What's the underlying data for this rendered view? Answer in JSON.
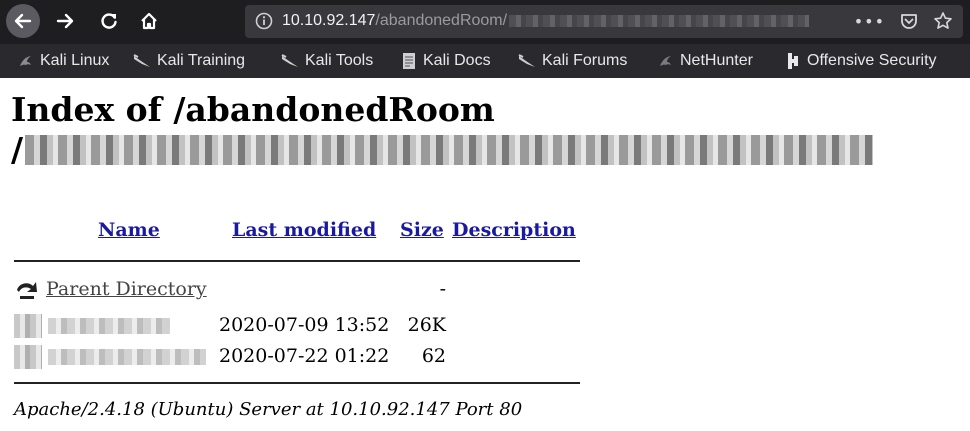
{
  "browser": {
    "url_host": "10.10.92.147",
    "url_path": "/abandonedRoom/",
    "more_label": "•••",
    "icons": [
      "back-icon",
      "forward-icon",
      "reload-icon",
      "home-icon",
      "info-icon",
      "pocket-icon",
      "bookmark-star-icon"
    ]
  },
  "bookmarks": [
    {
      "label": "Kali Linux",
      "icon": "kali-dragon-icon"
    },
    {
      "label": "Kali Training",
      "icon": "kali-dragon-icon"
    },
    {
      "label": "Kali Tools",
      "icon": "kali-dragon-icon"
    },
    {
      "label": "Kali Docs",
      "icon": "document-icon"
    },
    {
      "label": "Kali Forums",
      "icon": "kali-dragon-icon"
    },
    {
      "label": "NetHunter",
      "icon": "nethunter-icon"
    },
    {
      "label": "Offensive Security",
      "icon": "offsec-icon"
    }
  ],
  "page": {
    "title_line1": "Index of /abandonedRoom",
    "title_line2_prefix": "/",
    "columns": {
      "name": "Name",
      "last_modified": "Last modified",
      "size": "Size",
      "description": "Description"
    },
    "parent": {
      "name": "Parent Directory",
      "size": "-"
    },
    "files": [
      {
        "date": "2020-07-09 13:52",
        "size": "26K"
      },
      {
        "date": "2020-07-22 01:22",
        "size": "62"
      }
    ],
    "server_signature": "Apache/2.4.18 (Ubuntu) Server at 10.10.92.147 Port 80"
  }
}
